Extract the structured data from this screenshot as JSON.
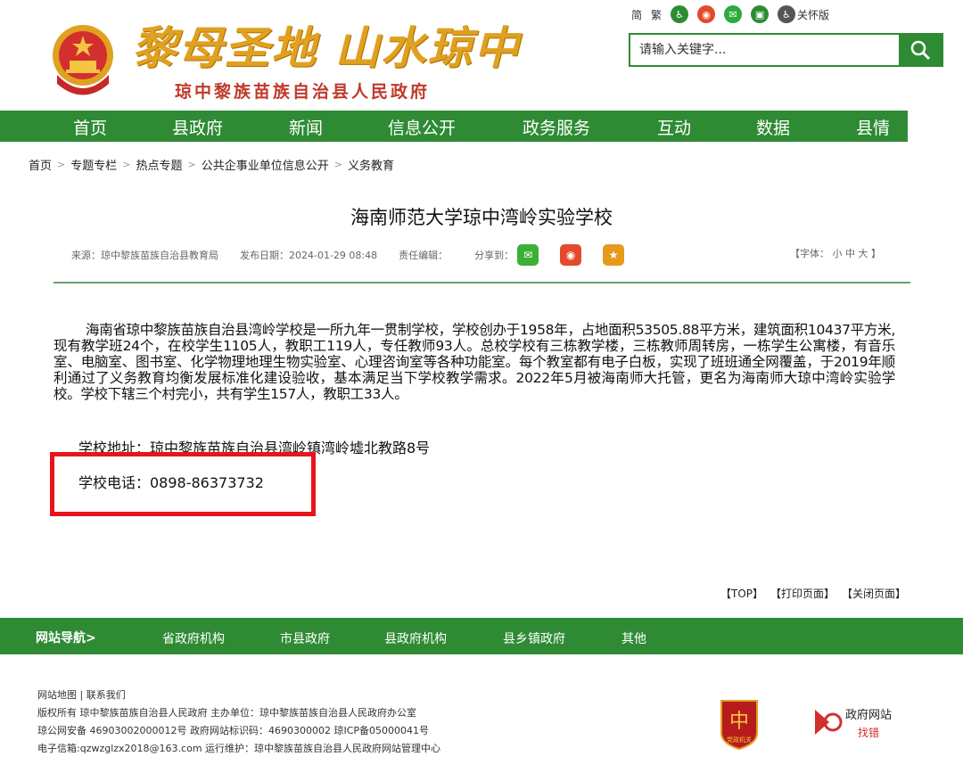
{
  "header": {
    "slogan": "黎母圣地 山水琼中",
    "gov_name": "琼中黎族苗族自治县人民政府",
    "tools": {
      "simplified": "简",
      "traditional": "繁",
      "elder_mode": "关怀版"
    },
    "search_placeholder": "请输入关键字..."
  },
  "nav": [
    "首页",
    "县政府",
    "新闻",
    "信息公开",
    "政务服务",
    "互动",
    "数据",
    "县情"
  ],
  "breadcrumb": [
    "首页",
    "专题专栏",
    "热点专题",
    "公共企事业单位信息公开",
    "义务教育"
  ],
  "article": {
    "title": "海南师范大学琼中湾岭实验学校",
    "source": "来源：琼中黎族苗族自治县教育局",
    "date": "发布日期：2024-01-29 08:48",
    "editor": "责任编辑：",
    "share": "分享到：",
    "font_size": "【字体： 小  中  大 】",
    "body": "海南省琼中黎族苗族自治县湾岭学校是一所九年一贯制学校，学校创办于1958年，占地面积53505.88平方米，建筑面积10437平方米,现有教学班24个，在校学生1105人，教职工119人，专任教师93人。总校学校有三栋教学楼，三栋教师周转房，一栋学生公寓楼，有音乐室、电脑室、图书室、化学物理地理生物实验室、心理咨询室等各种功能室。每个教室都有电子白板，实现了班班通全网覆盖，于2019年顺利通过了义务教育均衡发展标准化建设验收，基本满足当下学校教学需求。2022年5月被海南师大托管，更名为海南师大琼中湾岭实验学校。学校下辖三个村完小，共有学生157人，教职工33人。",
    "address": "学校地址：琼中黎族苗族自治县湾岭镇湾岭墟北教路8号",
    "phone": "学校电话：0898-86373732",
    "actions": [
      "【TOP】",
      "【打印页面】",
      "【关闭页面】"
    ]
  },
  "footer_nav": {
    "lead": "网站导航>",
    "items": [
      "省政府机构",
      "市县政府",
      "县政府机构",
      "县乡镇政府",
      "其他"
    ]
  },
  "footer": {
    "links": "网站地图   |   联系我们",
    "line1": "版权所有 琼中黎族苗族自治县人民政府  主办单位：琼中黎族苗族自治县人民政府办公室",
    "line2": "琼公网安备 46903002000012号  政府网站标识码：4690300002  琼ICP备05000041号",
    "line3": "电子信箱:qzwzglzx2018@163.com  运行维护：琼中黎族苗族自治县人民政府网站管理中心",
    "badge_text": "党政机关",
    "finder_title": "政府网站",
    "finder_sub": "找错"
  },
  "colors": {
    "green": "#2e8b34",
    "red_box": "#e8141c",
    "gold": "#e0a020"
  }
}
